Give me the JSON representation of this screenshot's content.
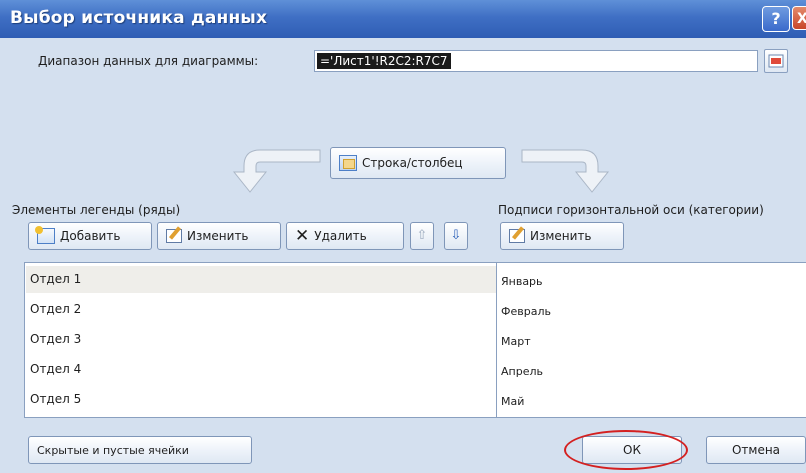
{
  "dialog": {
    "title": "Выбор источника данных",
    "help_label": "?",
    "close_label": "X",
    "range_label": "Диапазон данных для диаграммы:",
    "range_value": "='Лист1'!R2C2:R7C7",
    "switch_button": "Строка/столбец",
    "legend_header": "Элементы легенды (ряды)",
    "axis_header": "Подписи горизонтальной оси (категории)",
    "add_button": "Добавить",
    "edit_button": "Изменить",
    "delete_button": "Удалить",
    "move_up": "⇧",
    "move_down": "⇩",
    "axis_edit_button": "Изменить",
    "series": [
      "Отдел 1",
      "Отдел 2",
      "Отдел 3",
      "Отдел 4",
      "Отдел 5"
    ],
    "categories": [
      "Январь",
      "Февраль",
      "Март",
      "Апрель",
      "Май"
    ],
    "hidden_cells_button": "Скрытые и пустые ячейки",
    "ok_button": "ОК",
    "cancel_button": "Отмена"
  },
  "colors": {
    "titlebar": "#3f6fc4",
    "highlight_ring": "#d42020",
    "dialog_bg": "#d4e0ef"
  }
}
